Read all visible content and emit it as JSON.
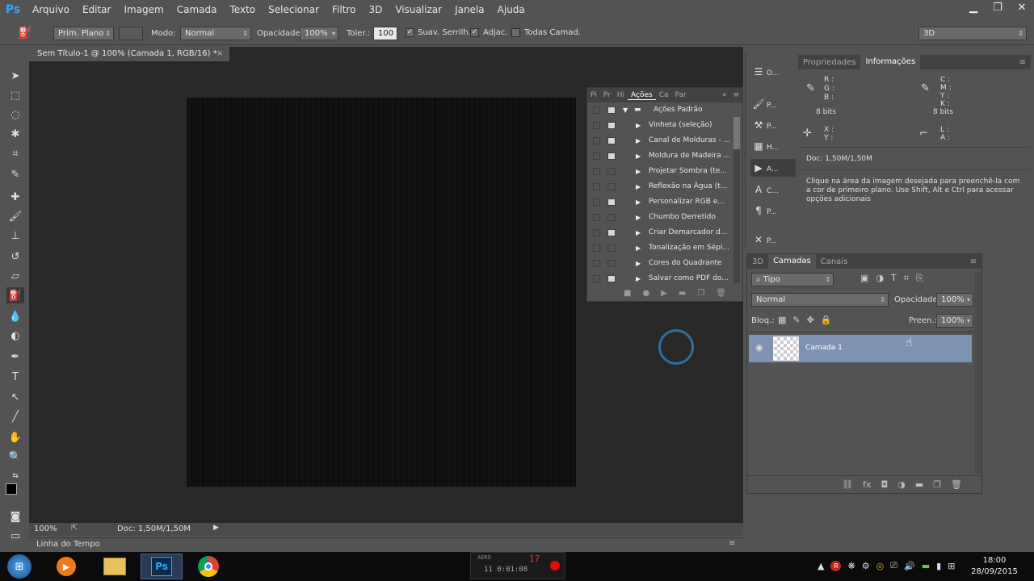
{
  "app": {
    "logo": "Ps",
    "workspace": "3D"
  },
  "menu": [
    "Arquivo",
    "Editar",
    "Imagem",
    "Camada",
    "Texto",
    "Selecionar",
    "Filtro",
    "3D",
    "Visualizar",
    "Janela",
    "Ajuda"
  ],
  "window_controls": {
    "minimize": "▁",
    "restore": "❐",
    "close": "✕"
  },
  "options": {
    "fill_source": "Prim. Plano",
    "mode_label": "Modo:",
    "mode_value": "Normal",
    "opacity_label": "Opacidade:",
    "opacity_value": "100%",
    "tolerance_label": "Toler.:",
    "tolerance_value": "100",
    "antialias_label": "Suav. Serrilh.",
    "contiguous_label": "Adjac.",
    "all_layers_label": "Todas Camad.",
    "antialias_checked": true,
    "contiguous_checked": true,
    "all_layers_checked": false
  },
  "document": {
    "tab_title": "Sem Título-1 @ 100% (Camada 1, RGB/16) *",
    "tab_close": "×",
    "zoom": "100%",
    "doc_size": "Doc: 1,50M/1,50M"
  },
  "timeline": {
    "label": "Linha do Tempo"
  },
  "actions_panel": {
    "tabs": [
      "Pi",
      "Pr",
      "Hi",
      "Ações",
      "Ca",
      "Par"
    ],
    "active_tab": "Ações",
    "set_name": "Ações Padrão",
    "items": [
      "Vinheta (seleção)",
      "Canal de Molduras - ...",
      "Moldura de Madeira ...",
      "Projetar Sombra (te...",
      "Reflexão na Água (t...",
      "Personalizar RGB e...",
      "Chumbo Derretido",
      "Criar Demarcador d...",
      "Tonalização em Sépi...",
      "Cores do Quadrante",
      "Salvar como PDF do..."
    ]
  },
  "dock": {
    "items": [
      {
        "label": "O...",
        "icon": "history-icon"
      },
      {
        "label": "P...",
        "icon": "brush-preset-icon"
      },
      {
        "label": "P...",
        "icon": "tool-presets-icon"
      },
      {
        "label": "H...",
        "icon": "swatches-icon"
      },
      {
        "label": "A...",
        "icon": "actions-play-icon"
      },
      {
        "label": "C...",
        "icon": "character-icon"
      },
      {
        "label": "P...",
        "icon": "paragraph-icon"
      },
      {
        "label": "P...",
        "icon": "tools-icon"
      }
    ]
  },
  "info_panel": {
    "tabs": [
      "Propriedades",
      "Informações"
    ],
    "active_tab": "Informações",
    "rgb_labels": [
      "R :",
      "G :",
      "B :"
    ],
    "cmyk_labels": [
      "C :",
      "M :",
      "Y :",
      "K :"
    ],
    "bits_left": "8 bits",
    "bits_right": "8 bits",
    "xy_labels": [
      "X :",
      "Y :"
    ],
    "la_labels": [
      "L :",
      "A :"
    ],
    "doc": "Doc: 1,50M/1,50M",
    "hint": "Clique na área da imagem desejada para preenchê-la com a cor de primeiro plano. Use Shift, Alt e Ctrl para acessar opções adicionais"
  },
  "layers_panel": {
    "tabs": [
      "3D",
      "Camadas",
      "Canais"
    ],
    "active_tab": "Camadas",
    "filter": "Tipo",
    "blend_mode": "Normal",
    "opacity_label": "Opacidade:",
    "opacity_value": "100%",
    "lock_label": "Bloq.:",
    "fill_label": "Preen.:",
    "fill_value": "100%",
    "layers": [
      {
        "name": "Camada 1",
        "visible": true
      }
    ]
  },
  "taskbar": {
    "time": "18:00",
    "date": "28/09/2015",
    "recorder_top": "AERO",
    "recorder_count": "17",
    "recorder_clock": "11  0:01:08"
  }
}
